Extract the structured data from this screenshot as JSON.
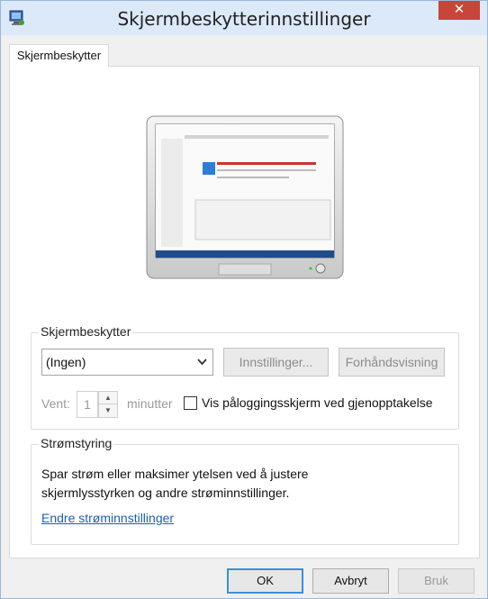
{
  "window": {
    "title": "Skjermbeskytterinnstillinger",
    "close_symbol": "✕",
    "icon": "screensaver-settings-icon"
  },
  "tab": {
    "label": "Skjermbeskytter"
  },
  "screensaver": {
    "group_label": "Skjermbeskytter",
    "selected": "(Ingen)",
    "settings_label": "Innstillinger...",
    "preview_label": "Forhåndsvisning",
    "wait_label": "Vent:",
    "wait_value": "1",
    "minutes_label": "minutter",
    "logon_checkbox_label": "Vis påloggingsskjerm ved gjenopptakelse",
    "logon_checked": false
  },
  "power": {
    "group_label": "Strømstyring",
    "description_line1": "Spar strøm eller maksimer ytelsen ved å justere",
    "description_line2": "skjermlysstyrken og andre strøminnstillinger.",
    "link_label": "Endre strøminnstillinger"
  },
  "buttons": {
    "ok": "OK",
    "cancel": "Avbryt",
    "apply": "Bruk"
  },
  "colors": {
    "titlebar": "#dbe9f9",
    "close": "#c7453a",
    "link": "#1e5fb0",
    "default_button_border": "#3c8fd8"
  }
}
